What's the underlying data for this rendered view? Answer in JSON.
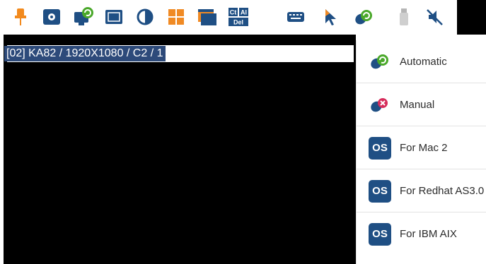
{
  "toolbar": {
    "icons": [
      {
        "name": "pin-icon"
      },
      {
        "name": "settings-icon"
      },
      {
        "name": "auto-sync-monitor-icon"
      },
      {
        "name": "fullscreen-icon"
      },
      {
        "name": "contrast-icon"
      },
      {
        "name": "grid-layout-icon"
      },
      {
        "name": "windows-icon"
      },
      {
        "name": "ctrl-alt-del-icon",
        "text_top_left": "Ct",
        "text_top_right": "Al",
        "text_bottom": "Del"
      },
      {
        "name": "keyboard-icon"
      },
      {
        "name": "cursor-icon"
      },
      {
        "name": "mouse-sync-icon"
      },
      {
        "name": "usb-icon"
      },
      {
        "name": "mute-icon"
      }
    ],
    "colors": {
      "accent_blue": "#1f4f84",
      "pin_orange": "#f28a1e",
      "grid_orange": "#f08a24",
      "sync_green": "#4aa82a"
    }
  },
  "status": {
    "text": "[02] KA82 / 1920X1080 / C2 / 1"
  },
  "menu": {
    "items": [
      {
        "label": "Automatic",
        "icon": "mouse-auto-sync-icon"
      },
      {
        "label": "Manual",
        "icon": "mouse-manual-icon"
      },
      {
        "label": "For Mac 2",
        "badge": "OS"
      },
      {
        "label": "For Redhat AS3.0",
        "badge": "OS"
      },
      {
        "label": "For IBM AIX",
        "badge": "OS"
      }
    ]
  }
}
